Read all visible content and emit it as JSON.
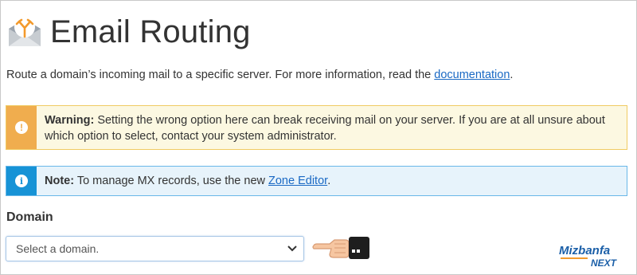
{
  "page": {
    "title": "Email Routing",
    "description_pre": "Route a domain’s incoming mail to a specific server. For more information, read the ",
    "description_link": "documentation",
    "description_post": "."
  },
  "warning": {
    "icon": "exclamation-icon",
    "label": "Warning:",
    "text": " Setting the wrong option here can break receiving mail on your server. If you are at all unsure about which option to select, contact your system administrator."
  },
  "note": {
    "icon": "info-icon",
    "label": "Note:",
    "text_pre": " To manage MX records, use the new ",
    "link": "Zone Editor",
    "text_post": "."
  },
  "domain_field": {
    "label": "Domain",
    "selected": "Select a domain."
  },
  "watermark": {
    "brand": "Mizbanfa",
    "suffix": "NEXT"
  },
  "colors": {
    "warning_accent": "#f0ad4e",
    "info_accent": "#1793d6",
    "link": "#1a69c4",
    "brand_orange": "#f39a2c"
  }
}
